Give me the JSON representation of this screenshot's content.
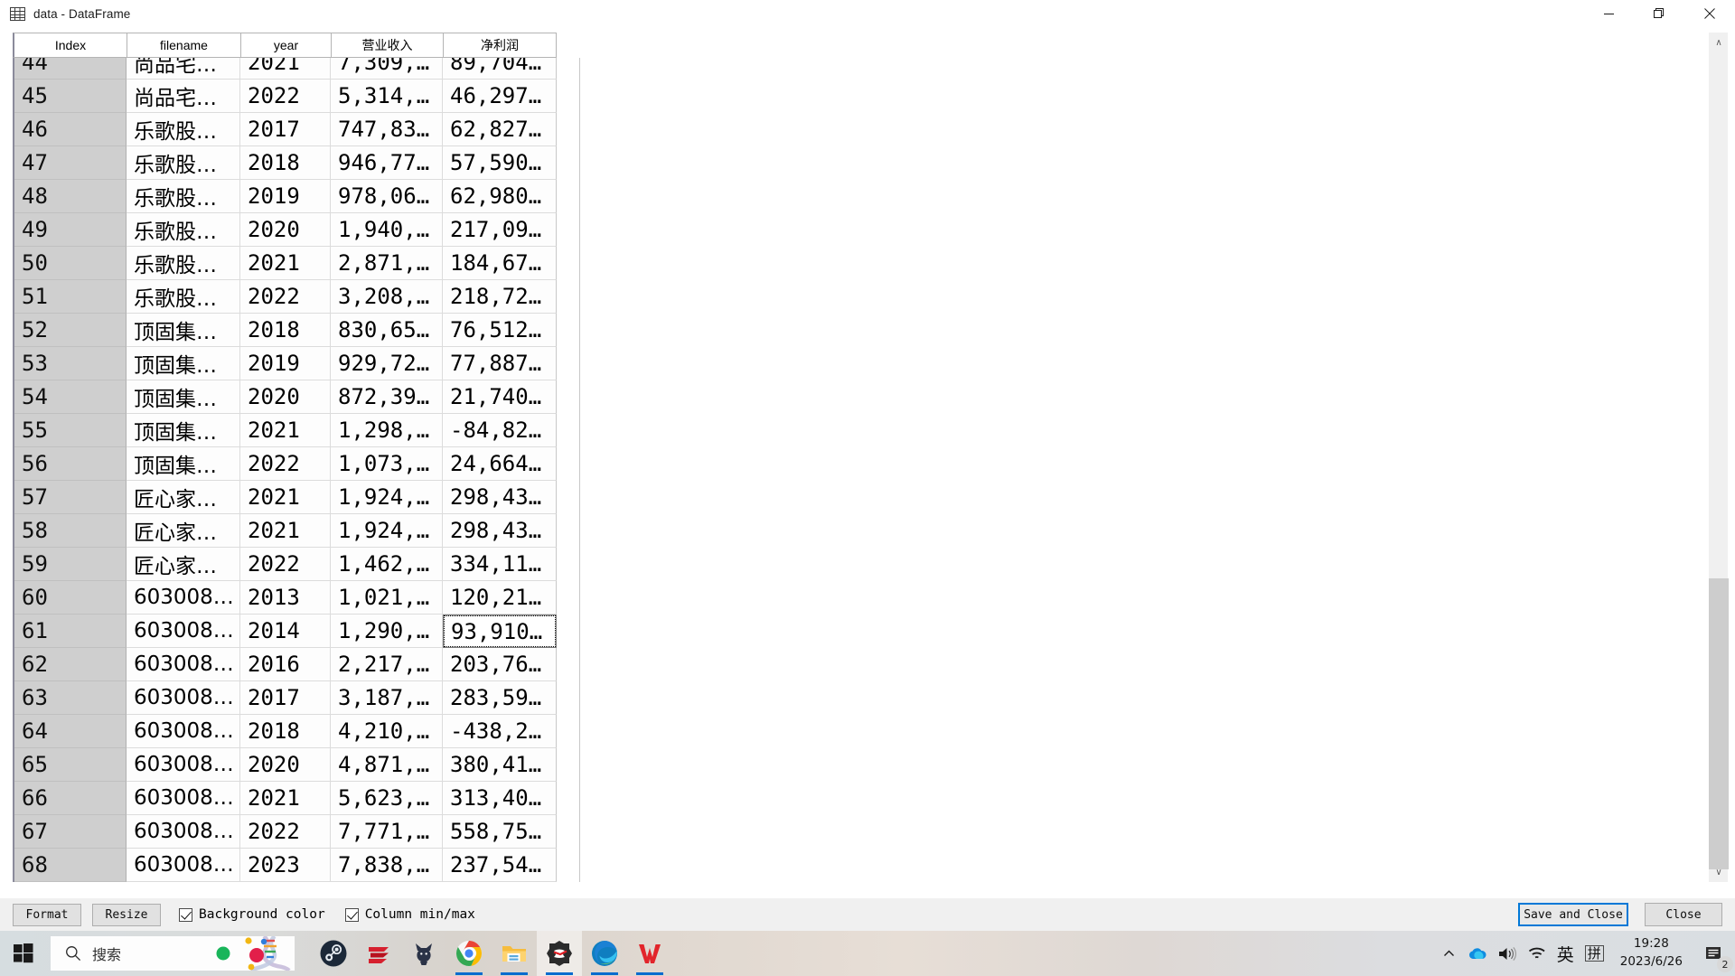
{
  "window": {
    "title": "data - DataFrame",
    "icon": "table-grid-icon",
    "controls": {
      "minimize": "—",
      "maximize": "❐",
      "close": "✕"
    }
  },
  "table": {
    "columns": [
      "Index",
      "filename",
      "year",
      "营业收入",
      "净利润"
    ],
    "selected_cell": {
      "row_index": "61",
      "column": "净利润",
      "value": "93,910…"
    },
    "rows": [
      {
        "index": "44",
        "filename": "尚品宅…",
        "year": "2021",
        "revenue": "7,309,…",
        "profit": "89,704…"
      },
      {
        "index": "45",
        "filename": "尚品宅…",
        "year": "2022",
        "revenue": "5,314,…",
        "profit": "46,297…"
      },
      {
        "index": "46",
        "filename": "乐歌股…",
        "year": "2017",
        "revenue": "747,83…",
        "profit": "62,827…"
      },
      {
        "index": "47",
        "filename": "乐歌股…",
        "year": "2018",
        "revenue": "946,77…",
        "profit": "57,590…"
      },
      {
        "index": "48",
        "filename": "乐歌股…",
        "year": "2019",
        "revenue": "978,06…",
        "profit": "62,980…"
      },
      {
        "index": "49",
        "filename": "乐歌股…",
        "year": "2020",
        "revenue": "1,940,…",
        "profit": "217,09…"
      },
      {
        "index": "50",
        "filename": "乐歌股…",
        "year": "2021",
        "revenue": "2,871,…",
        "profit": "184,67…"
      },
      {
        "index": "51",
        "filename": "乐歌股…",
        "year": "2022",
        "revenue": "3,208,…",
        "profit": "218,72…"
      },
      {
        "index": "52",
        "filename": "顶固集…",
        "year": "2018",
        "revenue": "830,65…",
        "profit": "76,512…"
      },
      {
        "index": "53",
        "filename": "顶固集…",
        "year": "2019",
        "revenue": "929,72…",
        "profit": "77,887…"
      },
      {
        "index": "54",
        "filename": "顶固集…",
        "year": "2020",
        "revenue": "872,39…",
        "profit": "21,740…"
      },
      {
        "index": "55",
        "filename": "顶固集…",
        "year": "2021",
        "revenue": "1,298,…",
        "profit": "-84,82…"
      },
      {
        "index": "56",
        "filename": "顶固集…",
        "year": "2022",
        "revenue": "1,073,…",
        "profit": "24,664…"
      },
      {
        "index": "57",
        "filename": "匠心家…",
        "year": "2021",
        "revenue": "1,924,…",
        "profit": "298,43…"
      },
      {
        "index": "58",
        "filename": "匠心家…",
        "year": "2021",
        "revenue": "1,924,…",
        "profit": "298,43…"
      },
      {
        "index": "59",
        "filename": "匠心家…",
        "year": "2022",
        "revenue": "1,462,…",
        "profit": "334,11…"
      },
      {
        "index": "60",
        "filename": "603008…",
        "year": "2013",
        "revenue": "1,021,…",
        "profit": "120,21…"
      },
      {
        "index": "61",
        "filename": "603008…",
        "year": "2014",
        "revenue": "1,290,…",
        "profit": "93,910…"
      },
      {
        "index": "62",
        "filename": "603008…",
        "year": "2016",
        "revenue": "2,217,…",
        "profit": "203,76…"
      },
      {
        "index": "63",
        "filename": "603008…",
        "year": "2017",
        "revenue": "3,187,…",
        "profit": "283,59…"
      },
      {
        "index": "64",
        "filename": "603008…",
        "year": "2018",
        "revenue": "4,210,…",
        "profit": "-438,2…"
      },
      {
        "index": "65",
        "filename": "603008…",
        "year": "2020",
        "revenue": "4,871,…",
        "profit": "380,41…"
      },
      {
        "index": "66",
        "filename": "603008…",
        "year": "2021",
        "revenue": "5,623,…",
        "profit": "313,40…"
      },
      {
        "index": "67",
        "filename": "603008…",
        "year": "2022",
        "revenue": "7,771,…",
        "profit": "558,75…"
      },
      {
        "index": "68",
        "filename": "603008…",
        "year": "2023",
        "revenue": "7,838,…",
        "profit": "237,54…"
      }
    ]
  },
  "toolbar": {
    "format_label": "Format",
    "resize_label": "Resize",
    "background_color_label": "Background color",
    "background_color_checked": true,
    "column_minmax_label": "Column min/max",
    "column_minmax_checked": true,
    "save_and_close_label": "Save and Close",
    "close_label": "Close",
    "focus_accent": "#0078d7"
  },
  "scrollbar": {
    "up_arrow": "∧",
    "down_arrow": "∨"
  },
  "taskbar": {
    "start_label": "Start",
    "search_placeholder": "搜索",
    "apps": [
      {
        "name": "steam",
        "running": false
      },
      {
        "name": "express-vpn",
        "running": false
      },
      {
        "name": "cat-app",
        "running": false
      },
      {
        "name": "google-chrome",
        "running": true
      },
      {
        "name": "file-explorer",
        "running": true
      },
      {
        "name": "wps-pdf",
        "running": true
      },
      {
        "name": "microsoft-edge",
        "running": true
      },
      {
        "name": "wps-office",
        "running": true
      }
    ],
    "tray": {
      "overflow": "∧",
      "onedrive": "onedrive-icon",
      "volume": "volume-icon",
      "network": "wifi-icon",
      "language": "英",
      "ime_mode": "拼",
      "time": "19:28",
      "date": "2023/6/26",
      "notification_count": "2"
    }
  }
}
